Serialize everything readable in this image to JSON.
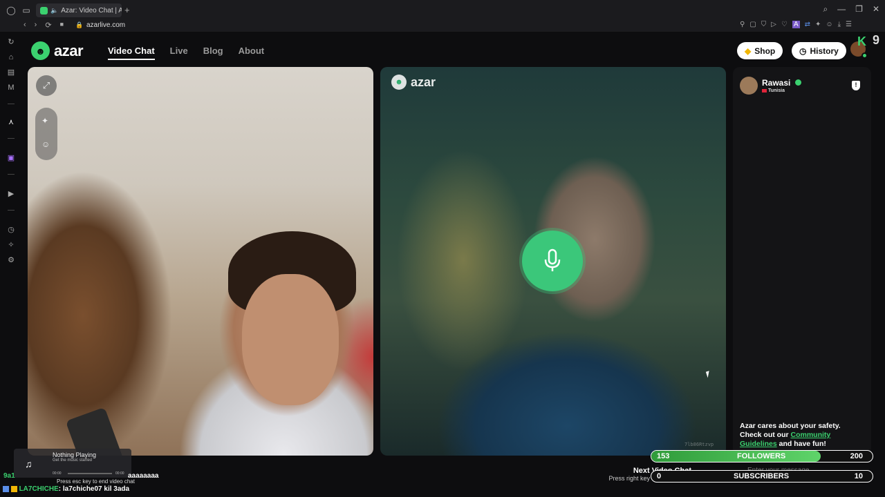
{
  "browser": {
    "tab_title": "Azar: Video Chat | Alt",
    "new_tab": "+",
    "url": "azarlive.com",
    "nav": {
      "back": "‹",
      "forward": "›",
      "reload": "⟳"
    }
  },
  "header": {
    "logo_text": "azar",
    "nav": [
      {
        "label": "Video Chat",
        "active": true
      },
      {
        "label": "Live",
        "active": false
      },
      {
        "label": "Blog",
        "active": false
      },
      {
        "label": "About",
        "active": false
      }
    ],
    "shop_label": "Shop",
    "history_label": "History"
  },
  "overlay": {
    "kick_letter": "K",
    "kick_count": "9"
  },
  "remote": {
    "logo_text": "azar",
    "session_code": "7lb86Rtzvp"
  },
  "partner": {
    "name": "Rawasi",
    "country": "Tunisia"
  },
  "safety": {
    "text_before": "Azar cares about your safety. Check out our ",
    "link": "Community Guidelines",
    "text_after": " and have fun!"
  },
  "chat": {
    "input_placeholder": "Enter your message"
  },
  "next_chat": {
    "title": "Next Video Chat",
    "hint": "Press right key to meet others"
  },
  "stream_goals": {
    "followers": {
      "current": "153",
      "label": "FOLLOWERS",
      "goal": "200",
      "progress": 0.765
    },
    "subscribers": {
      "current": "0",
      "label": "SUBSCRIBERS",
      "goal": "10",
      "progress": 0.0
    }
  },
  "music_widget": {
    "title": "Nothing Playing",
    "subtitle": "Get the music started",
    "time_start": "00:00",
    "time_end": "00:00"
  },
  "stream_chat": [
    {
      "user": "9a1",
      "message": "aaaaaaaa",
      "hint": "Press esc key to end video chat"
    },
    {
      "user": "LA7CHICHE",
      "message": ": la7chiche07 kil 3ada"
    }
  ],
  "colors": {
    "brand_green": "#3bd16f",
    "mic_green": "#3bc77a",
    "background": "#0d0d0f"
  }
}
